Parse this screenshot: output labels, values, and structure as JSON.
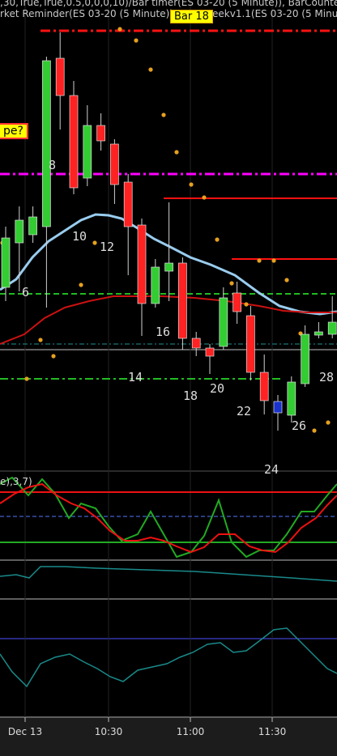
{
  "header": {
    "line1": ",30,True,True,0.5,0,0,0,10)/Bar timer(ES 03-20 (5 Minute)), BarCounte",
    "line2": "rket Reminder(ES 03-20 (5 Minute))",
    "line2b": "eekv1.1(ES 03-20 (5 Minu",
    "bar_badge": "Bar 18",
    "side_badge": "pe?"
  },
  "panel2": {
    "title": "e),3,7)"
  },
  "time_axis": {
    "labels": [
      {
        "text": "Dec 13",
        "name": "time-label-dec13"
      },
      {
        "text": "10:30",
        "name": "time-label-1030"
      },
      {
        "text": "11:00",
        "name": "time-label-1100"
      },
      {
        "text": "11:30",
        "name": "time-label-1130"
      }
    ]
  },
  "colors": {
    "background": "#000000",
    "bull": "#33cc33",
    "bear": "#ff2222",
    "neutral_candle": "#1a33cc",
    "sma": "#99ccee",
    "ema": "#cc1111",
    "magenta_level": "#ff00ff",
    "red_level": "#ff1111",
    "green_level": "#22bb22",
    "dots": "#e6a01e",
    "teal": "#1a8a8a"
  },
  "chart_data": {
    "type": "candlestick",
    "bar_number_labels": [
      "6",
      "8",
      "10",
      "12",
      "14",
      "16",
      "18",
      "20",
      "22",
      "24",
      "26",
      "28"
    ],
    "candles": [
      {
        "open": 355,
        "close": 294,
        "high": 280,
        "low": 372
      },
      {
        "open": 300,
        "close": 272,
        "high": 255,
        "low": 360
      },
      {
        "open": 290,
        "close": 268,
        "high": 255,
        "low": 300
      },
      {
        "open": 280,
        "close": 75,
        "high": 70,
        "low": 380
      },
      {
        "open": 72,
        "close": 118,
        "high": 40,
        "low": 160
      },
      {
        "open": 118,
        "close": 232,
        "high": 100,
        "low": 240
      },
      {
        "open": 220,
        "close": 155,
        "high": 130,
        "low": 230
      },
      {
        "open": 155,
        "close": 174,
        "high": 140,
        "low": 186
      },
      {
        "open": 178,
        "close": 228,
        "high": 172,
        "low": 252
      },
      {
        "open": 225,
        "close": 280,
        "high": 215,
        "low": 340
      },
      {
        "open": 278,
        "close": 375,
        "high": 270,
        "low": 415
      },
      {
        "open": 375,
        "close": 330,
        "high": 320,
        "low": 380
      },
      {
        "open": 335,
        "close": 325,
        "high": 250,
        "low": 372
      },
      {
        "open": 325,
        "close": 418,
        "high": 318,
        "low": 432
      },
      {
        "open": 418,
        "close": 430,
        "high": 410,
        "low": 440
      },
      {
        "open": 430,
        "close": 440,
        "high": 425,
        "low": 462
      },
      {
        "open": 428,
        "close": 368,
        "high": 355,
        "low": 432
      },
      {
        "open": 362,
        "close": 385,
        "high": 348,
        "low": 400
      },
      {
        "open": 390,
        "close": 460,
        "high": 378,
        "low": 470
      },
      {
        "open": 460,
        "close": 495,
        "high": 438,
        "low": 512
      },
      {
        "open": 496,
        "close": 510,
        "high": 488,
        "low": 532
      },
      {
        "open": 513,
        "close": 472,
        "high": 465,
        "low": 522
      },
      {
        "open": 474,
        "close": 413,
        "high": 402,
        "low": 478
      },
      {
        "open": 414,
        "close": 410,
        "high": 398,
        "low": 418
      },
      {
        "open": 413,
        "close": 398,
        "high": 366,
        "low": 418
      }
    ]
  }
}
